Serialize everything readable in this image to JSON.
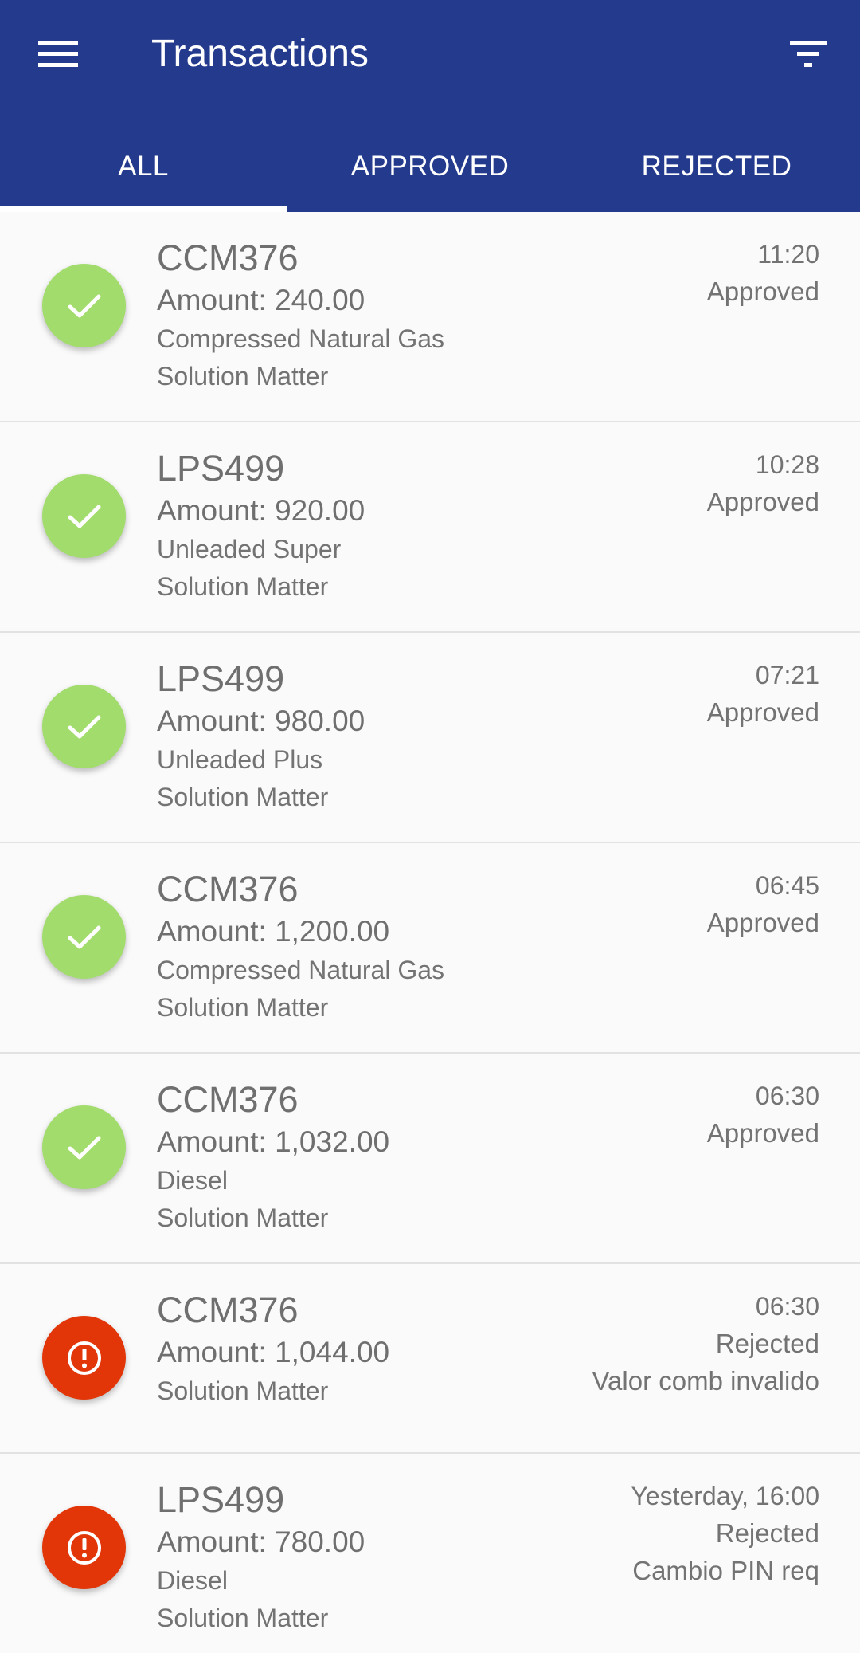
{
  "app_bar": {
    "title": "Transactions",
    "menu_icon": "hamburger-menu-icon",
    "filter_icon": "filter-icon",
    "background": "#233a8d"
  },
  "tabs": [
    {
      "label": "ALL",
      "active": true
    },
    {
      "label": "APPROVED",
      "active": false
    },
    {
      "label": "REJECTED",
      "active": false
    }
  ],
  "colors": {
    "approved": "#a2dc6c",
    "rejected": "#e23609"
  },
  "transactions": [
    {
      "plate": "CCM376",
      "amount": "Amount: 240.00",
      "lines": [
        "Compressed Natural Gas",
        "Solution Matter"
      ],
      "time": "11:20",
      "status": "Approved",
      "reason": "",
      "state": "approved"
    },
    {
      "plate": "LPS499",
      "amount": "Amount: 920.00",
      "lines": [
        "Unleaded Super",
        "Solution Matter"
      ],
      "time": "10:28",
      "status": "Approved",
      "reason": "",
      "state": "approved"
    },
    {
      "plate": "LPS499",
      "amount": "Amount: 980.00",
      "lines": [
        "Unleaded Plus",
        "Solution Matter"
      ],
      "time": "07:21",
      "status": "Approved",
      "reason": "",
      "state": "approved"
    },
    {
      "plate": "CCM376",
      "amount": "Amount: 1,200.00",
      "lines": [
        "Compressed Natural Gas",
        "Solution Matter"
      ],
      "time": "06:45",
      "status": "Approved",
      "reason": "",
      "state": "approved"
    },
    {
      "plate": "CCM376",
      "amount": "Amount: 1,032.00",
      "lines": [
        "Diesel",
        "Solution Matter"
      ],
      "time": "06:30",
      "status": "Approved",
      "reason": "",
      "state": "approved"
    },
    {
      "plate": "CCM376",
      "amount": "Amount: 1,044.00",
      "lines": [
        "Solution Matter"
      ],
      "time": "06:30",
      "status": "Rejected",
      "reason": "Valor comb invalido",
      "state": "rejected"
    },
    {
      "plate": "LPS499",
      "amount": "Amount: 780.00",
      "lines": [
        "Diesel",
        "Solution Matter"
      ],
      "time": "Yesterday, 16:00",
      "status": "Rejected",
      "reason": "Cambio PIN req",
      "state": "rejected"
    }
  ]
}
